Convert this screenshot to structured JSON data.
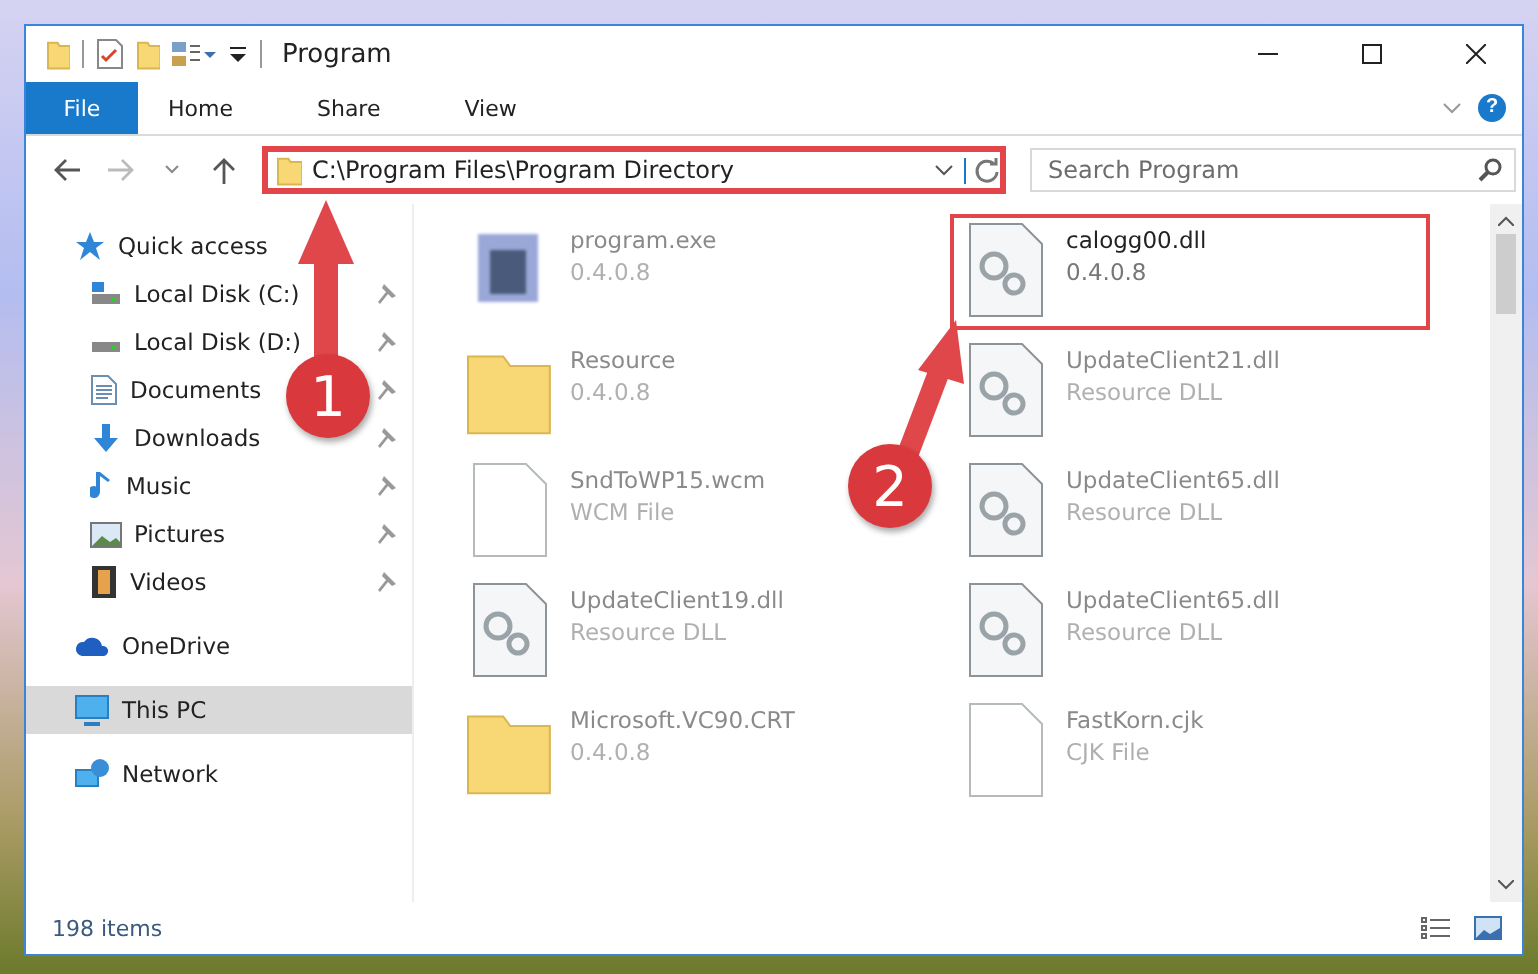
{
  "window": {
    "title": "Program"
  },
  "ribbon": {
    "tabs": [
      {
        "label": "File",
        "selected": true
      },
      {
        "label": "Home",
        "selected": false
      },
      {
        "label": "Share",
        "selected": false
      },
      {
        "label": "View",
        "selected": false
      }
    ],
    "help": "?"
  },
  "address": {
    "path": "C:\\Program Files\\Program Directory",
    "highlighted": true
  },
  "search": {
    "placeholder": "Search Program"
  },
  "nav": [
    {
      "label": "Quick access",
      "kind": "quick",
      "selected": false,
      "children": [
        {
          "label": "Local Disk (C:)",
          "kind": "drive-c",
          "pinned": true
        },
        {
          "label": "Local Disk (D:)",
          "kind": "drive",
          "pinned": true
        },
        {
          "label": "Documents",
          "kind": "documents",
          "pinned": true
        },
        {
          "label": "Downloads",
          "kind": "downloads",
          "pinned": true
        },
        {
          "label": "Music",
          "kind": "music",
          "pinned": true
        },
        {
          "label": "Pictures",
          "kind": "pictures",
          "pinned": true
        },
        {
          "label": "Videos",
          "kind": "videos",
          "pinned": true
        }
      ]
    },
    {
      "label": "OneDrive",
      "kind": "cloud",
      "selected": false
    },
    {
      "label": "This PC",
      "kind": "pc",
      "selected": true
    },
    {
      "label": "Network",
      "kind": "network",
      "selected": false
    }
  ],
  "files": [
    {
      "name": "program.exe",
      "detail": "0.4.0.8",
      "kind": "exe",
      "blurred": true,
      "highlighted": false
    },
    {
      "name": "calogg00.dll",
      "detail": "0.4.0.8",
      "kind": "dll",
      "blurred": false,
      "highlighted": true
    },
    {
      "name": "Resource",
      "detail": "0.4.0.8",
      "kind": "folder",
      "blurred": true,
      "highlighted": false
    },
    {
      "name": "UpdateClient21.dll",
      "detail": "Resource DLL",
      "kind": "dll",
      "blurred": true,
      "highlighted": false
    },
    {
      "name": "SndToWP15.wcm",
      "detail": "WCM File",
      "kind": "file",
      "blurred": true,
      "highlighted": false
    },
    {
      "name": "UpdateClient65.dll",
      "detail": "Resource DLL",
      "kind": "dll",
      "blurred": true,
      "highlighted": false
    },
    {
      "name": "UpdateClient19.dll",
      "detail": "Resource DLL",
      "kind": "dll",
      "blurred": true,
      "highlighted": false
    },
    {
      "name": "UpdateClient65.dll",
      "detail": "Resource DLL",
      "kind": "dll",
      "blurred": true,
      "highlighted": false
    },
    {
      "name": "Microsoft.VC90.CRT",
      "detail": "0.4.0.8",
      "kind": "folder",
      "blurred": true,
      "highlighted": false
    },
    {
      "name": "FastKorn.cjk",
      "detail": "CJK File",
      "kind": "file",
      "blurred": true,
      "highlighted": false
    }
  ],
  "status_bar": {
    "items": "198 items"
  },
  "annotations": [
    {
      "number": "1"
    },
    {
      "number": "2"
    }
  ]
}
